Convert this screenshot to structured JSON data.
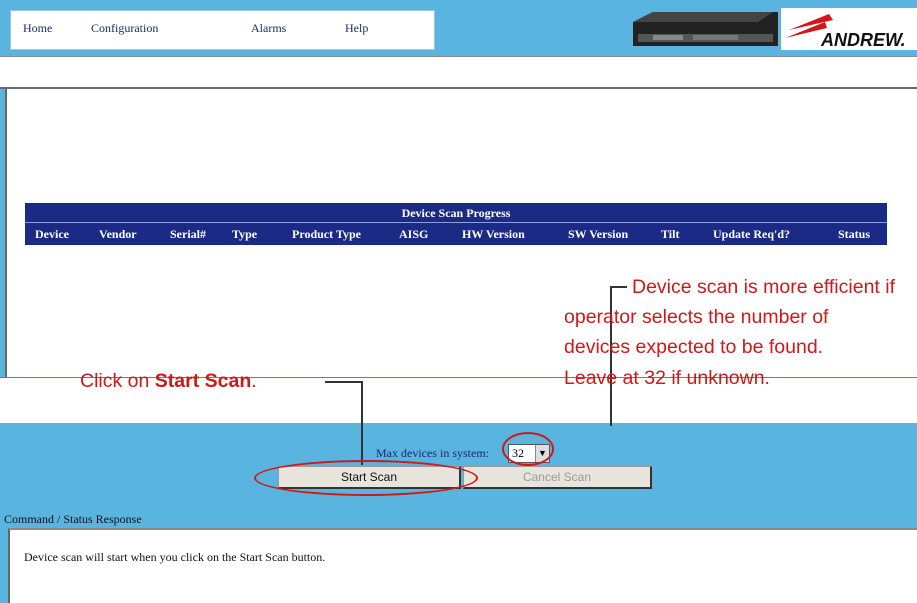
{
  "nav": {
    "items": [
      "Home",
      "Configuration",
      "Alarms",
      "Help"
    ]
  },
  "brand": {
    "logo_text": "ANDREW."
  },
  "table": {
    "title": "Device Scan Progress",
    "columns": [
      "Device",
      "Vendor",
      "Serial#",
      "Type",
      "Product Type",
      "AISG",
      "HW Version",
      "SW Version",
      "Tilt",
      "Update Req'd?",
      "Status"
    ]
  },
  "annotations": {
    "scan_efficiency": [
      "Device scan is more efficient if",
      "operator selects the number of",
      "devices expected to be found.",
      "Leave at 32 if unknown."
    ],
    "click_prefix": "Click on ",
    "click_bold": "Start Scan",
    "click_suffix": "."
  },
  "controls": {
    "max_devices_label": "Max devices in system:",
    "max_devices_value": "32",
    "start_scan_label": "Start Scan",
    "cancel_scan_label": "Cancel Scan"
  },
  "status": {
    "label": "Command / Status Response",
    "message": "Device scan will start when you click on the Start Scan button."
  },
  "colors": {
    "page_bg": "#5ab4e0",
    "table_header": "#1a2a85",
    "annotation_red": "#d01818"
  }
}
